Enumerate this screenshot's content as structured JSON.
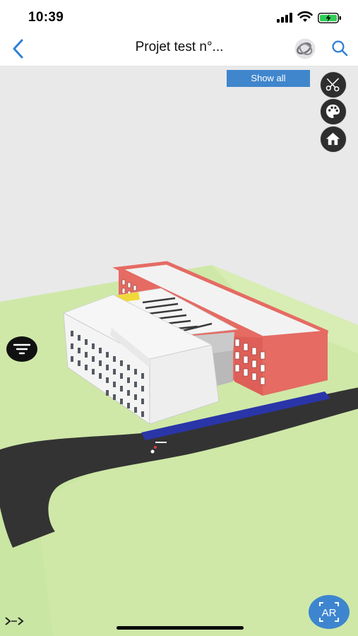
{
  "status_bar": {
    "time": "10:39"
  },
  "nav": {
    "title": "Projet test n°..."
  },
  "viewer": {
    "show_all_label": "Show all"
  },
  "ar_button": {
    "label": "AR"
  },
  "icons": {
    "back": "chevron-left-icon",
    "logo": "app-logo-icon",
    "search": "search-icon",
    "cut": "scissors-icon",
    "palette": "palette-icon",
    "home": "home-icon",
    "filter": "filter-icon",
    "ar": "ar-icon"
  },
  "colors": {
    "accent": "#3f86cd",
    "ground": "#cfe8a8",
    "road": "#333333",
    "brick": "#e56b63",
    "building_white": "#f4f4f4",
    "blue_strip": "#2a35a8"
  }
}
